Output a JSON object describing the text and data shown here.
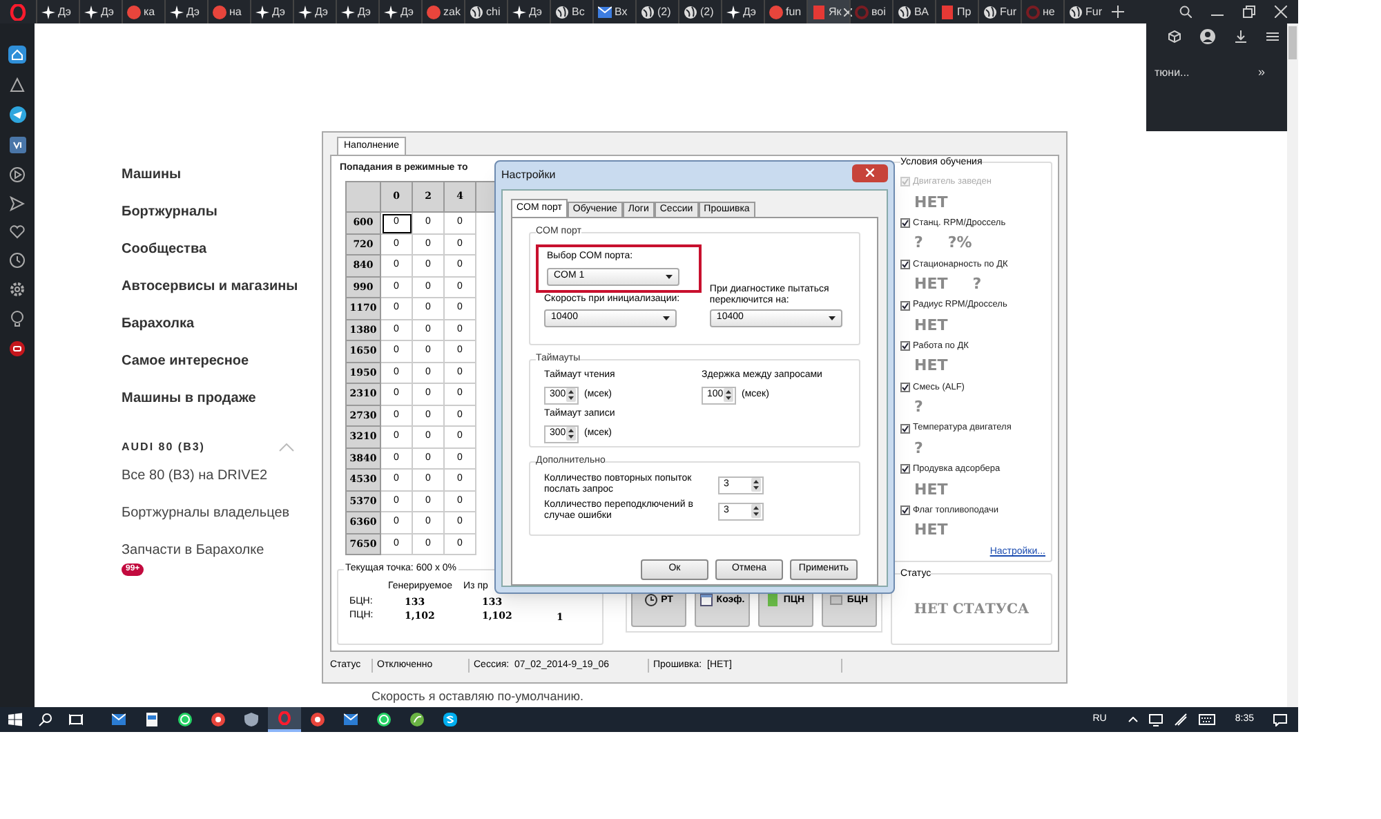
{
  "browser_tabs": [
    {
      "label": "Дэ",
      "kind": "drive",
      "selected": false
    },
    {
      "label": "Дэ",
      "kind": "drive",
      "selected": false
    },
    {
      "label": "ка",
      "kind": "yandex",
      "selected": false
    },
    {
      "label": "Дэ",
      "kind": "drive",
      "selected": false
    },
    {
      "label": "на",
      "kind": "yandex",
      "selected": false
    },
    {
      "label": "Дэ",
      "kind": "drive",
      "selected": false
    },
    {
      "label": "Дэ",
      "kind": "drive",
      "selected": false
    },
    {
      "label": "Дэ",
      "kind": "drive",
      "selected": false
    },
    {
      "label": "Дэ",
      "kind": "drive",
      "selected": false
    },
    {
      "label": "zak",
      "kind": "yandex",
      "selected": false
    },
    {
      "label": "chi",
      "kind": "globe",
      "selected": false
    },
    {
      "label": "Дэ",
      "kind": "drive",
      "selected": false
    },
    {
      "label": "Вс",
      "kind": "globe",
      "selected": false
    },
    {
      "label": "Вх",
      "kind": "mail",
      "selected": false
    },
    {
      "label": "(2)",
      "kind": "globe",
      "selected": false
    },
    {
      "label": "(2)",
      "kind": "globe",
      "selected": false
    },
    {
      "label": "Дэ",
      "kind": "drive",
      "selected": false
    },
    {
      "label": "fun",
      "kind": "yandex",
      "selected": false
    },
    {
      "label": "Як",
      "kind": "square",
      "selected": true
    },
    {
      "label": "воі",
      "kind": "ring",
      "selected": false
    },
    {
      "label": "ВА",
      "kind": "globe",
      "selected": false
    },
    {
      "label": "Пр",
      "kind": "square",
      "selected": false
    },
    {
      "label": "Fur",
      "kind": "globe",
      "selected": false
    },
    {
      "label": "не",
      "kind": "ring",
      "selected": false
    },
    {
      "label": "Fur",
      "kind": "globe",
      "selected": false
    }
  ],
  "toolbar": {
    "text": "тюни...",
    "more": "»"
  },
  "side_nav": {
    "items": [
      "Машины",
      "Бортжурналы",
      "Сообщества",
      "Автосервисы и магазины",
      "Барахолка",
      "Самое интересное",
      "Машины в продаже"
    ],
    "section": {
      "title": "AUDI 80 (B3)",
      "expanded": true,
      "items": [
        {
          "label": "Все 80 (B3) на DRIVE2"
        },
        {
          "label": "Бортжурналы владельцев"
        },
        {
          "label": "Запчасти в Барахолке",
          "badge": "99+"
        }
      ]
    }
  },
  "app": {
    "tabs": [
      {
        "label": "Наполнение",
        "selected": true
      }
    ],
    "grid": {
      "title": "Попадания в режимные то",
      "columns": [
        "0",
        "2",
        "4"
      ],
      "rows": [
        {
          "label": "600",
          "cells": [
            {
              "value": "0",
              "selected": true
            },
            {
              "value": "0",
              "selected": false
            },
            {
              "value": "0",
              "selected": false
            }
          ]
        },
        {
          "label": "720",
          "cells": [
            {
              "value": "0",
              "selected": false
            },
            {
              "value": "0",
              "selected": false
            },
            {
              "value": "0",
              "selected": false
            }
          ]
        },
        {
          "label": "840",
          "cells": [
            {
              "value": "0",
              "selected": false
            },
            {
              "value": "0",
              "selected": false
            },
            {
              "value": "0",
              "selected": false
            }
          ]
        },
        {
          "label": "990",
          "cells": [
            {
              "value": "0",
              "selected": false
            },
            {
              "value": "0",
              "selected": false
            },
            {
              "value": "0",
              "selected": false
            }
          ]
        },
        {
          "label": "1170",
          "cells": [
            {
              "value": "0",
              "selected": false
            },
            {
              "value": "0",
              "selected": false
            },
            {
              "value": "0",
              "selected": false
            }
          ]
        },
        {
          "label": "1380",
          "cells": [
            {
              "value": "0",
              "selected": false
            },
            {
              "value": "0",
              "selected": false
            },
            {
              "value": "0",
              "selected": false
            }
          ]
        },
        {
          "label": "1650",
          "cells": [
            {
              "value": "0",
              "selected": false
            },
            {
              "value": "0",
              "selected": false
            },
            {
              "value": "0",
              "selected": false
            }
          ]
        },
        {
          "label": "1950",
          "cells": [
            {
              "value": "0",
              "selected": false
            },
            {
              "value": "0",
              "selected": false
            },
            {
              "value": "0",
              "selected": false
            }
          ]
        },
        {
          "label": "2310",
          "cells": [
            {
              "value": "0",
              "selected": false
            },
            {
              "value": "0",
              "selected": false
            },
            {
              "value": "0",
              "selected": false
            }
          ]
        },
        {
          "label": "2730",
          "cells": [
            {
              "value": "0",
              "selected": false
            },
            {
              "value": "0",
              "selected": false
            },
            {
              "value": "0",
              "selected": false
            }
          ]
        },
        {
          "label": "3210",
          "cells": [
            {
              "value": "0",
              "selected": false
            },
            {
              "value": "0",
              "selected": false
            },
            {
              "value": "0",
              "selected": false
            }
          ]
        },
        {
          "label": "3840",
          "cells": [
            {
              "value": "0",
              "selected": false
            },
            {
              "value": "0",
              "selected": false
            },
            {
              "value": "0",
              "selected": false
            }
          ]
        },
        {
          "label": "4530",
          "cells": [
            {
              "value": "0",
              "selected": false
            },
            {
              "value": "0",
              "selected": false
            },
            {
              "value": "0",
              "selected": false
            }
          ]
        },
        {
          "label": "5370",
          "cells": [
            {
              "value": "0",
              "selected": false
            },
            {
              "value": "0",
              "selected": false
            },
            {
              "value": "0",
              "selected": false
            }
          ]
        },
        {
          "label": "6360",
          "cells": [
            {
              "value": "0",
              "selected": false
            },
            {
              "value": "0",
              "selected": false
            },
            {
              "value": "0",
              "selected": false
            }
          ]
        },
        {
          "label": "7650",
          "cells": [
            {
              "value": "0",
              "selected": false
            },
            {
              "value": "0",
              "selected": false
            },
            {
              "value": "0",
              "selected": false
            }
          ]
        }
      ]
    },
    "current_point": {
      "title": "Текущая точка: 600 x 0%",
      "headers": [
        "Генерируемое",
        "Из пр"
      ],
      "rows": [
        {
          "label": "БЦН:",
          "values": [
            "133",
            "133"
          ]
        },
        {
          "label": "ПЦН:",
          "values": [
            "1,102",
            "1,102"
          ]
        }
      ],
      "extra": "1"
    },
    "mode_buttons": [
      {
        "label": "РТ",
        "kind": "clock"
      },
      {
        "label": "Коэф.",
        "kind": "window"
      },
      {
        "label": "ПЦН",
        "kind": "green"
      },
      {
        "label": "БЦН",
        "kind": "gray"
      }
    ],
    "conditions": {
      "title": "Условия обучения",
      "items": [
        {
          "label": "Двигатель заведен",
          "checked": true,
          "disabled": true,
          "values": [
            "НЕТ"
          ]
        },
        {
          "label": "Станц. RPM/Дроссель",
          "checked": true,
          "disabled": false,
          "values": [
            "?",
            "?%"
          ]
        },
        {
          "label": "Стационарность по ДК",
          "checked": true,
          "disabled": false,
          "values": [
            "НЕТ",
            "?"
          ]
        },
        {
          "label": "Радиус RPM/Дроссель",
          "checked": true,
          "disabled": false,
          "values": [
            "НЕТ"
          ]
        },
        {
          "label": "Работа по ДК",
          "checked": true,
          "disabled": false,
          "values": [
            "НЕТ"
          ]
        },
        {
          "label": "Смесь (ALF)",
          "checked": true,
          "disabled": false,
          "values": [
            "?"
          ]
        },
        {
          "label": "Температура двигателя",
          "checked": true,
          "disabled": false,
          "values": [
            "?"
          ]
        },
        {
          "label": "Продувка адсорбера",
          "checked": true,
          "disabled": false,
          "values": [
            "НЕТ"
          ]
        },
        {
          "label": "Флаг топливоподачи",
          "checked": true,
          "disabled": false,
          "values": [
            "НЕТ"
          ]
        }
      ],
      "link": "Настройки..."
    },
    "status": {
      "title": "Статус",
      "text": "НЕТ СТАТУСА"
    },
    "status_bar": [
      "Статус",
      "Отключенно",
      "Сессия:  07_02_2014-9_19_06",
      "Прошивка:  [НЕТ]"
    ]
  },
  "dialog": {
    "title": "Настройки",
    "tabs": [
      {
        "label": "COM порт",
        "selected": true
      },
      {
        "label": "Обучение",
        "selected": false
      },
      {
        "label": "Логи",
        "selected": false
      },
      {
        "label": "Сессии",
        "selected": false
      },
      {
        "label": "Прошивка",
        "selected": false
      }
    ],
    "com_group": {
      "title": "COM порт",
      "port_label": "Выбор COM порта:",
      "port": "COM 1",
      "highlighted": true,
      "speed_label": "Скорость при инициализации:",
      "speed": "10400",
      "switch_label": "При диагностике пытаться переключится на:",
      "switch_speed": "10400"
    },
    "timeouts": {
      "title": "Таймауты",
      "fields": [
        {
          "label": "Таймаут чтения",
          "value": "300",
          "unit": "(мсек)"
        },
        {
          "label": "Здержка между запросами",
          "value": "100",
          "unit": "(мсек)"
        },
        {
          "label": "Таймаут записи",
          "value": "300",
          "unit": "(мсек)"
        }
      ]
    },
    "extra": {
      "title": "Дополнительно",
      "fields": [
        {
          "label": "Колличество повторных попыток послать запрос",
          "value": "3"
        },
        {
          "label": "Колличество переподключений в случае ошибки",
          "value": "3"
        }
      ]
    },
    "buttons": [
      "Ок",
      "Отмена",
      "Применить"
    ]
  },
  "caption": "Скорость я оставляю по-умолчанию.",
  "taskbar": {
    "apps": [
      {
        "kind": "mail",
        "selected": false
      },
      {
        "kind": "files",
        "selected": false
      },
      {
        "kind": "whatsapp",
        "selected": false
      },
      {
        "kind": "yandex",
        "selected": false
      },
      {
        "kind": "shield",
        "selected": false
      },
      {
        "kind": "opera",
        "selected": true
      },
      {
        "kind": "yandex",
        "selected": false
      },
      {
        "kind": "mail",
        "selected": false
      },
      {
        "kind": "whatsapp",
        "selected": false
      },
      {
        "kind": "green",
        "selected": false
      },
      {
        "kind": "skype",
        "selected": false
      }
    ],
    "language": "RU",
    "time": "8:35"
  }
}
